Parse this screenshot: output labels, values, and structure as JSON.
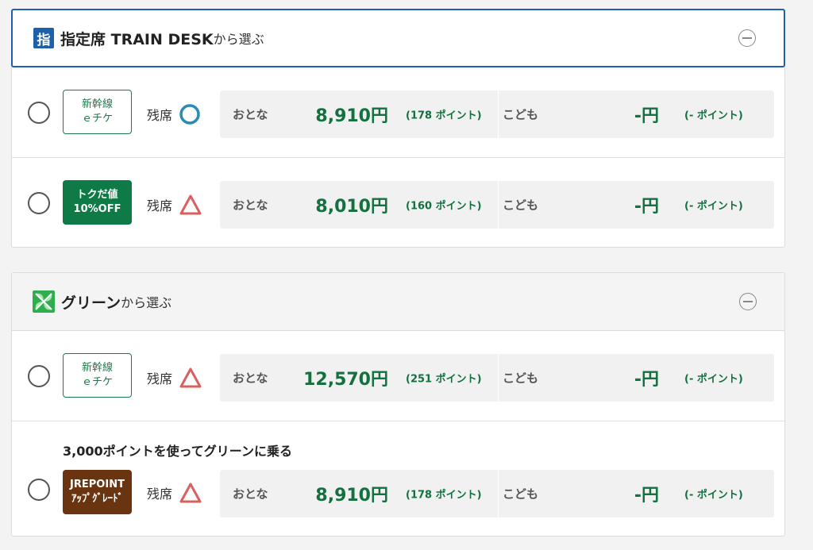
{
  "sections": [
    {
      "icon": "指",
      "title_bold": "指定席 TRAIN DESK",
      "title_sub": "から選ぶ",
      "rows": [
        {
          "badge_line1": "新幹線",
          "badge_line2": "ｅチケ",
          "availability_label": "残席",
          "availability_mark": "circle",
          "adult_label": "おとな",
          "adult_price": "8,910円",
          "adult_points": "(178 ポイント)",
          "child_label": "こども",
          "child_price": "-円",
          "child_points": "(- ポイント)"
        },
        {
          "badge_line1": "トクだ値",
          "badge_line2": "10%OFF",
          "availability_label": "残席",
          "availability_mark": "triangle",
          "adult_label": "おとな",
          "adult_price": "8,010円",
          "adult_points": "(160 ポイント)",
          "child_label": "こども",
          "child_price": "-円",
          "child_points": "(- ポイント)"
        }
      ]
    },
    {
      "icon": "green-clover-icon",
      "title_bold": "グリーン",
      "title_sub": "から選ぶ",
      "rows": [
        {
          "badge_line1": "新幹線",
          "badge_line2": "ｅチケ",
          "availability_label": "残席",
          "availability_mark": "triangle",
          "adult_label": "おとな",
          "adult_price": "12,570円",
          "adult_points": "(251 ポイント)",
          "child_label": "こども",
          "child_price": "-円",
          "child_points": "(- ポイント)"
        },
        {
          "note": "3,000ポイントを使ってグリーンに乗る",
          "badge_line1": "JREPOINT",
          "badge_line2": "ｱｯﾌﾟｸﾞﾚｰﾄﾞ",
          "availability_label": "残席",
          "availability_mark": "triangle",
          "adult_label": "おとな",
          "adult_price": "8,910円",
          "adult_points": "(178 ポイント)",
          "child_label": "こども",
          "child_price": "-円",
          "child_points": "(- ポイント)"
        }
      ]
    }
  ],
  "colors": {
    "accent_blue": "#1e5fb4",
    "price_green": "#13703f",
    "badge_green": "#0e7a45",
    "badge_brown": "#6b3410",
    "circle_mark": "#2a8bb7",
    "triangle_mark": "#d9605f"
  }
}
